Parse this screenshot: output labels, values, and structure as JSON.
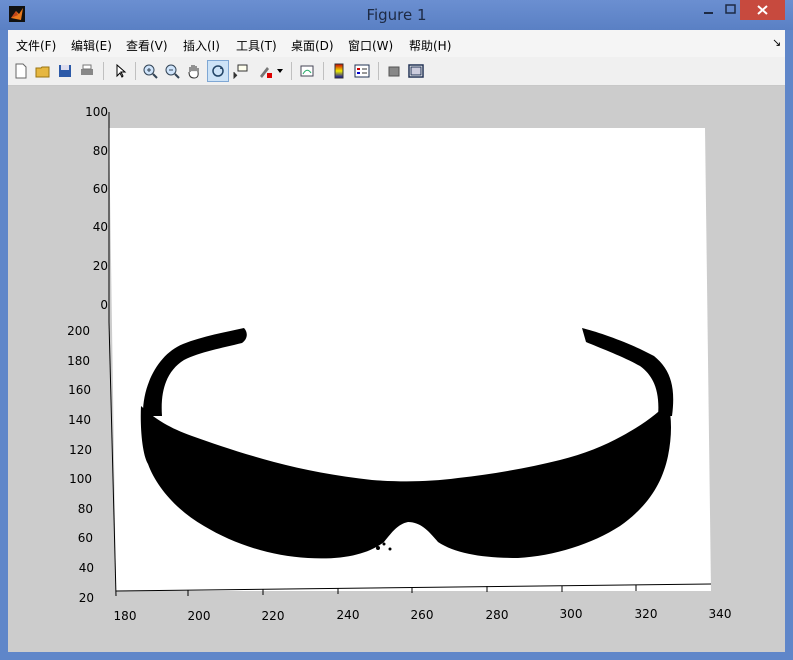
{
  "window": {
    "title": "Figure 1"
  },
  "menu": [
    "文件(F)",
    "编辑(E)",
    "查看(V)",
    "插入(I)",
    "工具(T)",
    "桌面(D)",
    "窗口(W)",
    "帮助(H)"
  ],
  "menu_overflow": "↘",
  "toolbar_icons": [
    "new-figure-icon",
    "open-file-icon",
    "save-icon",
    "print-icon",
    "pointer-icon",
    "zoom-in-icon",
    "zoom-out-icon",
    "pan-hand-icon",
    "rotate-3d-icon",
    "data-cursor-icon",
    "brush-icon",
    "brush-dropdown-icon",
    "link-plot-icon",
    "colorbar-icon",
    "legend-icon",
    "hide-plot-tools-icon",
    "show-plot-tools-icon"
  ],
  "axes": {
    "z_ticks": [
      "100",
      "80",
      "60",
      "40",
      "20",
      "0"
    ],
    "y_ticks": [
      "200",
      "180",
      "160",
      "140",
      "120",
      "100",
      "80",
      "60",
      "40",
      "20"
    ],
    "x_ticks": [
      "180",
      "200",
      "220",
      "240",
      "260",
      "280",
      "300",
      "320",
      "340"
    ]
  },
  "colors": {
    "plot_bg": "#ffffff",
    "figure_bg": "#cccccc",
    "points": "#000000"
  }
}
